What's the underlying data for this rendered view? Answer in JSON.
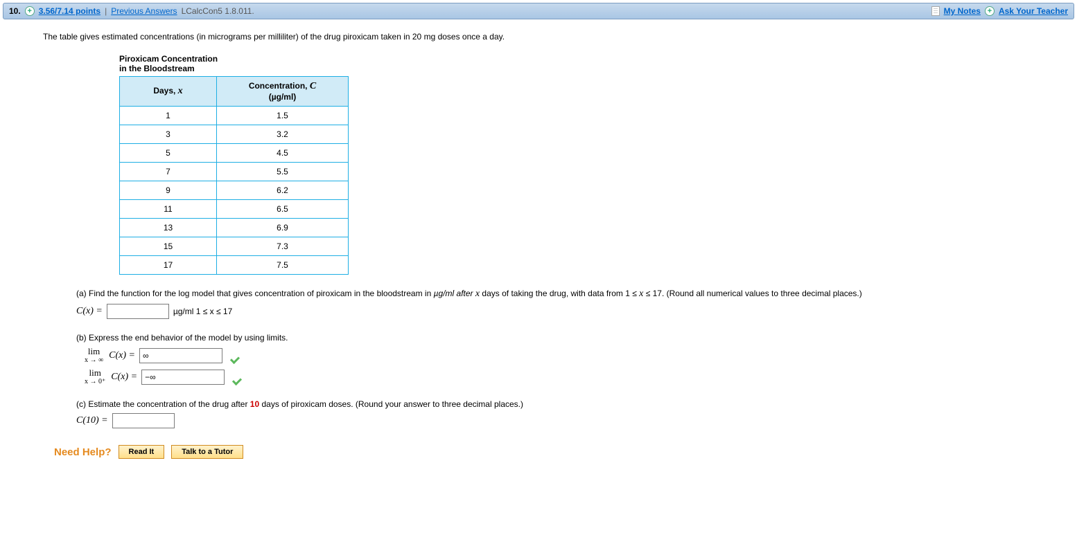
{
  "header": {
    "question_number": "10.",
    "points": "3.56/7.14 points",
    "previous_answers": "Previous Answers",
    "question_id": "LCalcCon5 1.8.011.",
    "my_notes": "My Notes",
    "ask_teacher": "Ask Your Teacher"
  },
  "intro": "The table gives estimated concentrations (in micrograms per milliliter) of the drug piroxicam taken in 20 mg doses once a day.",
  "table": {
    "title1": "Piroxicam Concentration",
    "title2": "in the Bloodstream",
    "col1_a": "Days, ",
    "col1_b": "x",
    "col2_a": "Concentration, ",
    "col2_b": "C",
    "col2_c": "(µg/ml)",
    "rows": [
      {
        "x": "1",
        "c": "1.5"
      },
      {
        "x": "3",
        "c": "3.2"
      },
      {
        "x": "5",
        "c": "4.5"
      },
      {
        "x": "7",
        "c": "5.5"
      },
      {
        "x": "9",
        "c": "6.2"
      },
      {
        "x": "11",
        "c": "6.5"
      },
      {
        "x": "13",
        "c": "6.9"
      },
      {
        "x": "15",
        "c": "7.3"
      },
      {
        "x": "17",
        "c": "7.5"
      }
    ]
  },
  "parts": {
    "a_text_1": "(a) Find the function for the log model that gives concentration of piroxicam in the bloodstream in ",
    "a_text_2": "µg/ml after ",
    "a_text_3": " days of taking the drug, with data from  1 ≤ ",
    "a_text_4": " ≤ 17.  (Round all numerical values to three decimal places.)",
    "a_cx": "C(x) = ",
    "a_unit": "µg/ml   1 ≤ x ≤ 17",
    "b_text": "(b) Express the end behavior of the model by using limits.",
    "b_lim1_top": "lim",
    "b_lim1_sub": "x → ∞",
    "b_lim_cx": "C(x)  = ",
    "b_val1": "∞",
    "b_lim2_top": "lim",
    "b_lim2_sub": "x → 0⁺",
    "b_val2": "−∞",
    "c_text_1": "(c) Estimate the concentration of the drug after ",
    "c_days": "10",
    "c_text_2": " days of piroxicam doses. (Round your answer to three decimal places.)",
    "c_cx": "C(10) = "
  },
  "help": {
    "label": "Need Help?",
    "read": "Read It",
    "tutor": "Talk to a Tutor"
  },
  "chart_data": {
    "type": "table",
    "title": "Piroxicam Concentration in the Bloodstream",
    "columns": [
      "Days, x",
      "Concentration, C (µg/ml)"
    ],
    "rows": [
      [
        1,
        1.5
      ],
      [
        3,
        3.2
      ],
      [
        5,
        4.5
      ],
      [
        7,
        5.5
      ],
      [
        9,
        6.2
      ],
      [
        11,
        6.5
      ],
      [
        13,
        6.9
      ],
      [
        15,
        7.3
      ],
      [
        17,
        7.5
      ]
    ]
  }
}
